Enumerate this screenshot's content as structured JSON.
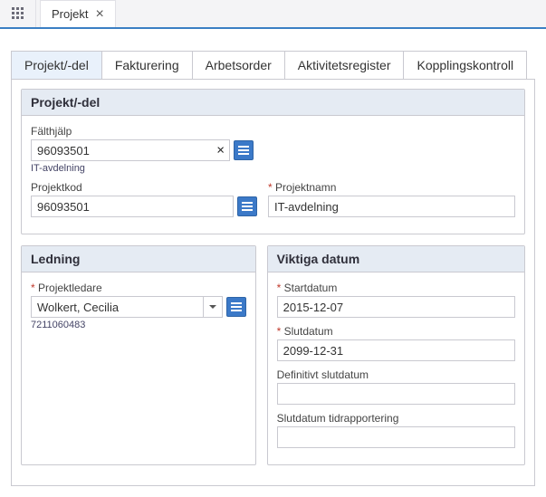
{
  "appTab": {
    "label": "Projekt"
  },
  "innerTabs": [
    {
      "label": "Projekt/-del",
      "active": true
    },
    {
      "label": "Fakturering"
    },
    {
      "label": "Arbetsorder"
    },
    {
      "label": "Aktivitetsregister"
    },
    {
      "label": "Kopplingskontroll"
    }
  ],
  "projektDel": {
    "header": "Projekt/-del",
    "faldhjalp_label": "Fälthjälp",
    "faldhjalp_value": "96093501",
    "faldhjalp_sub": "IT-avdelning",
    "projektkod_label": "Projektkod",
    "projektkod_value": "96093501",
    "projektnamn_label": "Projektnamn",
    "projektnamn_value": "IT-avdelning"
  },
  "ledning": {
    "header": "Ledning",
    "projektledare_label": "Projektledare",
    "projektledare_value": "Wolkert, Cecilia",
    "projektledare_sub": "7211060483"
  },
  "datum": {
    "header": "Viktiga datum",
    "start_label": "Startdatum",
    "start_value": "2015-12-07",
    "slut_label": "Slutdatum",
    "slut_value": "2099-12-31",
    "defslut_label": "Definitivt slutdatum",
    "defslut_value": "",
    "tidrapp_label": "Slutdatum tidrapportering",
    "tidrapp_value": ""
  }
}
